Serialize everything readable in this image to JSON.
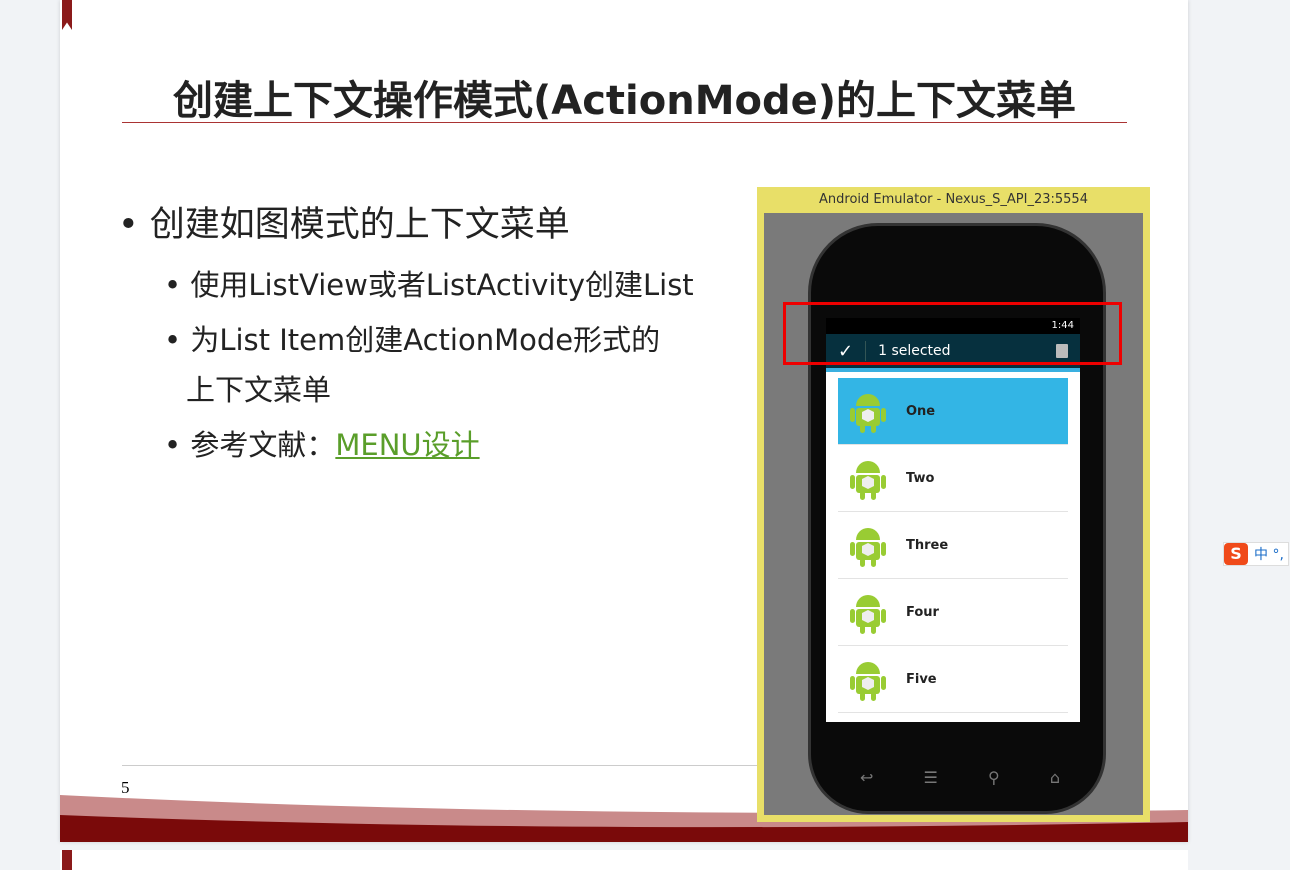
{
  "slide": {
    "title": "创建上下文操作模式(ActionMode)的上下文菜单",
    "bullet1": "创建如图模式的上下文菜单",
    "sub": [
      "使用ListView或者ListActivity创建List",
      "为List  Item创建ActionMode形式的",
      "上下文菜单"
    ],
    "ref_label": "参考文献：",
    "ref_link": "MENU设计",
    "page_number": "5"
  },
  "emulator": {
    "title": "Android Emulator - Nexus_S_API_23:5554",
    "time": "1:44",
    "action_title": "1 selected",
    "items": [
      "One",
      "Two",
      "Three",
      "Four",
      "Five"
    ]
  },
  "ime": {
    "icon": "S",
    "label": "中 °,"
  }
}
